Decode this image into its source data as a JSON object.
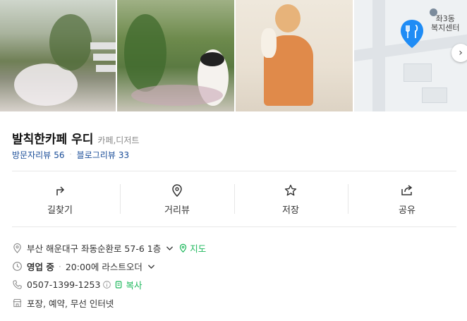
{
  "place": {
    "name": "발칙한카페 우디",
    "category": "카페,디저트"
  },
  "reviews": {
    "visitor_label": "방문자리뷰",
    "visitor_count": "56",
    "blog_label": "블로그리뷰",
    "blog_count": "33"
  },
  "map": {
    "label": "좌3동\n복지센터"
  },
  "actions": [
    {
      "label": "길찾기",
      "icon": "directions-icon"
    },
    {
      "label": "거리뷰",
      "icon": "street-view-icon"
    },
    {
      "label": "저장",
      "icon": "star-icon"
    },
    {
      "label": "공유",
      "icon": "share-icon"
    }
  ],
  "info": {
    "address": "부산 해운대구 좌동순환로 57-6 1층",
    "map_link": "지도",
    "status": "영업 중",
    "hours": "20:00에 라스트오더",
    "phone": "0507-1399-1253",
    "copy_label": "복사",
    "amenities": "포장, 예약, 무선 인터넷"
  },
  "colors": {
    "link_blue": "#1a4d98",
    "green": "#1eb85c",
    "pin_blue": "#1f8cf5"
  }
}
